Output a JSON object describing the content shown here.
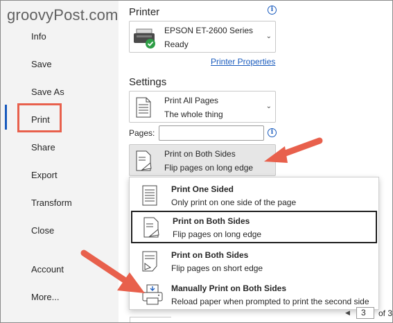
{
  "watermark": "groovyPost.com",
  "nav": {
    "items": [
      {
        "label": "Info"
      },
      {
        "label": "Save"
      },
      {
        "label": "Save As"
      },
      {
        "label": "Print"
      },
      {
        "label": "Share"
      },
      {
        "label": "Export"
      },
      {
        "label": "Transform"
      },
      {
        "label": "Close"
      },
      {
        "label": "Account"
      },
      {
        "label": "More..."
      }
    ],
    "selected": "Print"
  },
  "printer": {
    "heading": "Printer",
    "name": "EPSON ET-2600 Series",
    "status": "Ready",
    "properties_link": "Printer Properties"
  },
  "settings": {
    "heading": "Settings",
    "range": {
      "title": "Print All Pages",
      "subtitle": "The whole thing"
    },
    "pages_label": "Pages:",
    "pages_value": "",
    "sides": {
      "title": "Print on Both Sides",
      "subtitle": "Flip pages on long edge"
    }
  },
  "sides_menu": [
    {
      "title": "Print One Sided",
      "subtitle": "Only print on one side of the page",
      "icon": "one-sided-icon"
    },
    {
      "title": "Print on Both Sides",
      "subtitle": "Flip pages on long edge",
      "icon": "long-edge-icon",
      "selected": true
    },
    {
      "title": "Print on Both Sides",
      "subtitle": "Flip pages on short edge",
      "icon": "short-edge-icon"
    },
    {
      "title": "Manually Print on Both Sides",
      "subtitle": "Reload paper when prompted to print the second side",
      "icon": "manual-duplex-icon"
    }
  ],
  "page_nav": {
    "current": "3",
    "of_label": "of 3"
  },
  "colors": {
    "accent": "#185abd",
    "callout": "#e8604c",
    "sidebar": "#f3f3f3"
  }
}
